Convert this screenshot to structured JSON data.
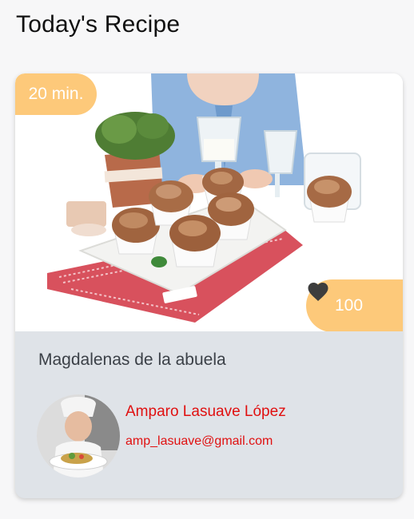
{
  "header": {
    "title": "Today's Recipe"
  },
  "recipe": {
    "time": "20 min.",
    "likes": "100",
    "name": "Magdalenas de la abuela",
    "image_alt": "muffins-photo"
  },
  "author": {
    "name": "Amparo Lasuave López",
    "email": "amp_lasuave@gmail.com"
  },
  "colors": {
    "badge": "#fdc97a",
    "card_background": "#dfe3e8",
    "author_text": "#e01010",
    "heart": "#3d3d3d"
  },
  "icons": {
    "likes": "heart-icon"
  }
}
